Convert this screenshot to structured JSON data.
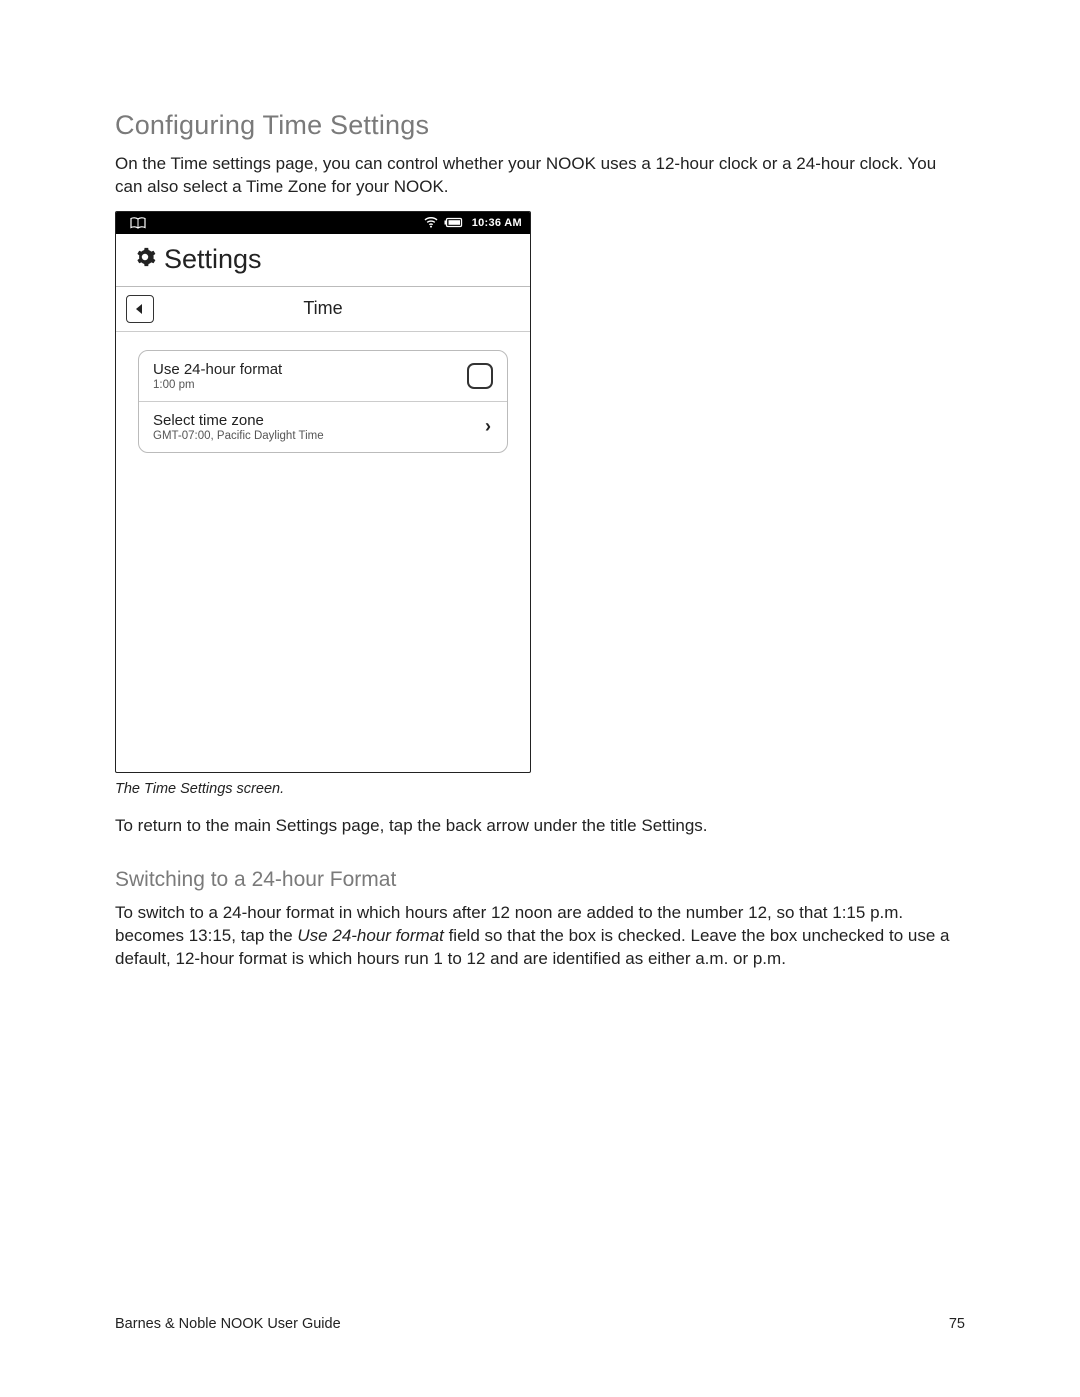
{
  "heading": "Configuring Time Settings",
  "intro": "On the Time settings page, you can control whether your NOOK uses a 12-hour clock or a 24-hour clock. You can also select a Time Zone for your NOOK.",
  "device": {
    "statusbar": {
      "time": "10:36 AM"
    },
    "app_title": "Settings",
    "page_title": "Time",
    "rows": {
      "format24": {
        "label": "Use 24-hour format",
        "sub": "1:00 pm"
      },
      "timezone": {
        "label": "Select time zone",
        "sub": "GMT-07:00, Pacific Daylight Time"
      }
    }
  },
  "caption": "The Time Settings screen.",
  "return_text": "To return to the main Settings page, tap the back arrow under the title Settings.",
  "subheading": "Switching to a 24-hour Format",
  "switch_paragraph": {
    "pre": "To switch to a 24-hour format in which hours after 12 noon are added to the number 12, so that 1:15 p.m. becomes 13:15, tap the ",
    "italic": "Use 24-hour format",
    "post": " field so that the box is checked. Leave the box unchecked to use a default, 12-hour format is which hours run 1 to 12 and are identified as either a.m. or p.m."
  },
  "footer": {
    "left": "Barnes & Noble NOOK User Guide",
    "right": "75"
  }
}
